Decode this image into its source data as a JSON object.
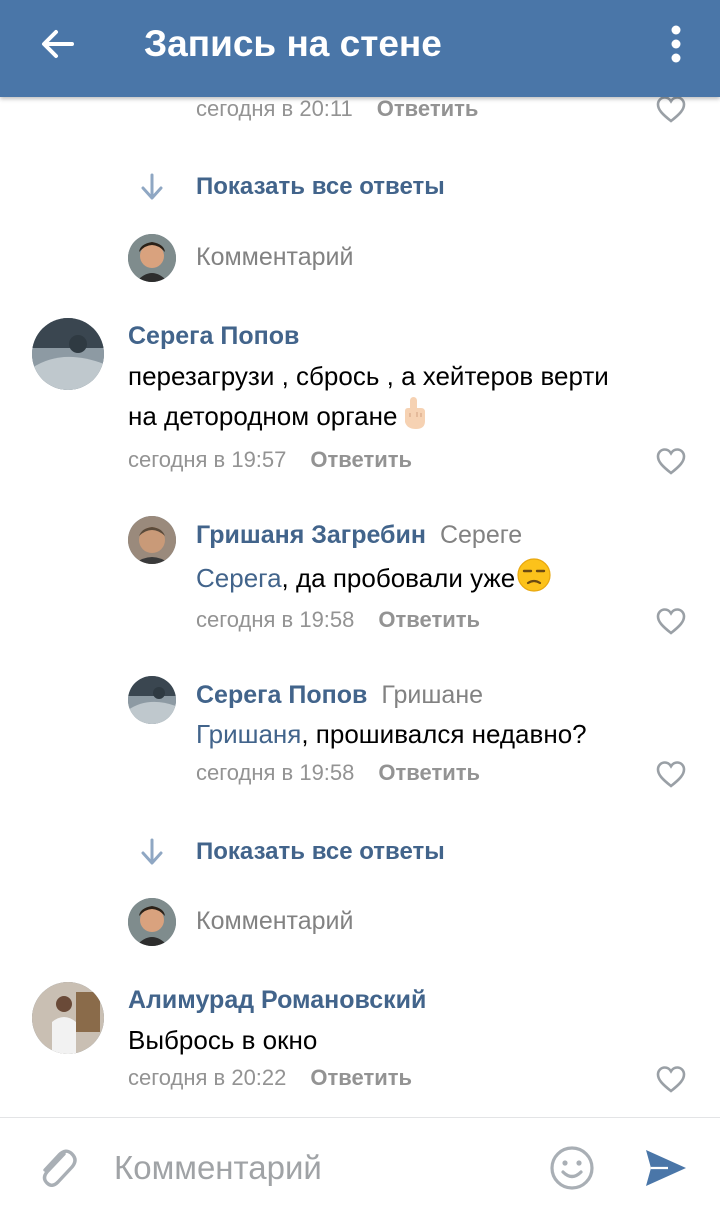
{
  "header": {
    "title": "Запись на стене"
  },
  "colors": {
    "header_bg": "#4a76a8",
    "link": "#42648b",
    "muted": "#939393",
    "accent": "#4a76a8"
  },
  "top_meta": {
    "time": "сегодня в 20:11",
    "reply": "Ответить"
  },
  "show_all_1": "Показать все ответы",
  "comment_hint_1": "Комментарий",
  "comments": [
    {
      "author": "Серега Попов",
      "text_line1": "перезагрузи , сбрось , а хейтеров верти",
      "text_line2": "на детородном органе",
      "emoji": "pointing-up-hand",
      "time": "сегодня в 19:57",
      "reply": "Ответить"
    },
    {
      "author": "Гришаня Загребин",
      "reply_to": "Сереге",
      "mention": "Серега",
      "text": ", да пробовали уже",
      "emoji": "unamused-face",
      "time": "сегодня в 19:58",
      "reply": "Ответить"
    },
    {
      "author": "Серега Попов",
      "reply_to": "Гришане",
      "mention": "Гришаня",
      "text": ", прошивался недавно?",
      "time": "сегодня в 19:58",
      "reply": "Ответить"
    },
    {
      "author": "Алимурад Романовский",
      "text": "Выбрось в окно",
      "time": "сегодня в 20:22",
      "reply": "Ответить"
    }
  ],
  "show_all_2": "Показать все ответы",
  "comment_hint_2": "Комментарий",
  "composer": {
    "placeholder": "Комментарий"
  }
}
